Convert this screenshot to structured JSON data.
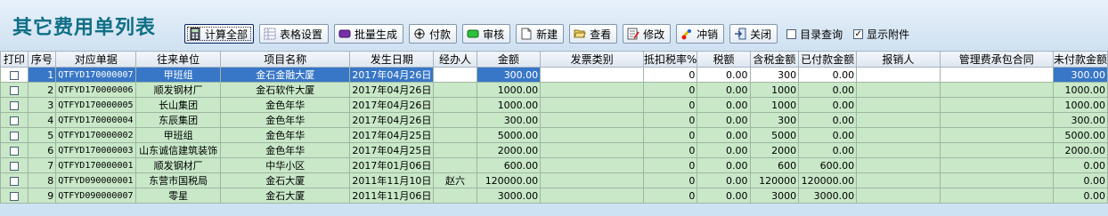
{
  "page": {
    "title": "其它费用单列表"
  },
  "toolbar": {
    "buttons": [
      {
        "label": "计算全部",
        "icon": "calculator-icon"
      },
      {
        "label": "表格设置",
        "icon": "table-settings-icon"
      },
      {
        "label": "批量生成",
        "icon": "batch-generate-icon"
      },
      {
        "label": "付款",
        "icon": "payment-icon"
      },
      {
        "label": "审核",
        "icon": "audit-icon"
      },
      {
        "label": "新建",
        "icon": "new-document-icon"
      },
      {
        "label": "查看",
        "icon": "folder-open-icon"
      },
      {
        "label": "修改",
        "icon": "edit-icon"
      },
      {
        "label": "冲销",
        "icon": "reverse-icon"
      },
      {
        "label": "关闭",
        "icon": "exit-icon"
      }
    ],
    "checkboxes": [
      {
        "label": "目录查询",
        "checked": false
      },
      {
        "label": "显示附件",
        "checked": true
      }
    ]
  },
  "table": {
    "columns": [
      "打印",
      "序号",
      "对应单据",
      "往来单位",
      "项目名称",
      "发生日期",
      "经办人",
      "金额",
      "发票类别",
      "抵扣税率%",
      "税额",
      "含税金额",
      "已付款金额",
      "报销人",
      "管理费承包合同",
      "未付款金额"
    ],
    "rows": [
      [
        "",
        "1",
        "QTFYD170000007",
        "甲班组",
        "金石金融大厦",
        "2017年04月26日",
        "",
        "300.00",
        "",
        "0",
        "0.00",
        "300",
        "0.00",
        "",
        "",
        "300.00"
      ],
      [
        "",
        "2",
        "QTFYD170000006",
        "顺发钢材厂",
        "金石软件大厦",
        "2017年04月26日",
        "",
        "1000.00",
        "",
        "0",
        "0.00",
        "1000",
        "0.00",
        "",
        "",
        "1000.00"
      ],
      [
        "",
        "3",
        "QTFYD170000005",
        "长山集团",
        "金色年华",
        "2017年04月26日",
        "",
        "1000.00",
        "",
        "0",
        "0.00",
        "1000",
        "0.00",
        "",
        "",
        "1000.00"
      ],
      [
        "",
        "4",
        "QTFYD170000004",
        "东辰集团",
        "金色年华",
        "2017年04月26日",
        "",
        "300.00",
        "",
        "0",
        "0.00",
        "300",
        "0.00",
        "",
        "",
        "300.00"
      ],
      [
        "",
        "5",
        "QTFYD170000002",
        "甲班组",
        "金色年华",
        "2017年04月25日",
        "",
        "5000.00",
        "",
        "0",
        "0.00",
        "5000",
        "0.00",
        "",
        "",
        "5000.00"
      ],
      [
        "",
        "6",
        "QTFYD170000003",
        "山东诚信建筑装饰",
        "金色年华",
        "2017年04月25日",
        "",
        "2000.00",
        "",
        "0",
        "0.00",
        "2000",
        "0.00",
        "",
        "",
        "2000.00"
      ],
      [
        "",
        "7",
        "QTFYD170000001",
        "顺发钢材厂",
        "中华小区",
        "2017年01月06日",
        "",
        "600.00",
        "",
        "0",
        "0.00",
        "600",
        "600.00",
        "",
        "",
        "0.00"
      ],
      [
        "",
        "8",
        "QTFYD090000001",
        "东营市国税局",
        "金石大厦",
        "2011年11月10日",
        "赵六",
        "120000.00",
        "",
        "0",
        "0.00",
        "120000",
        "120000.00",
        "",
        "",
        "0.00"
      ],
      [
        "",
        "9",
        "QTFYD090000007",
        "零星",
        "金石大厦",
        "2011年11月06日",
        "",
        "3000.00",
        "",
        "0",
        "0.00",
        "3000",
        "3000.00",
        "",
        "",
        "0.00"
      ]
    ]
  }
}
